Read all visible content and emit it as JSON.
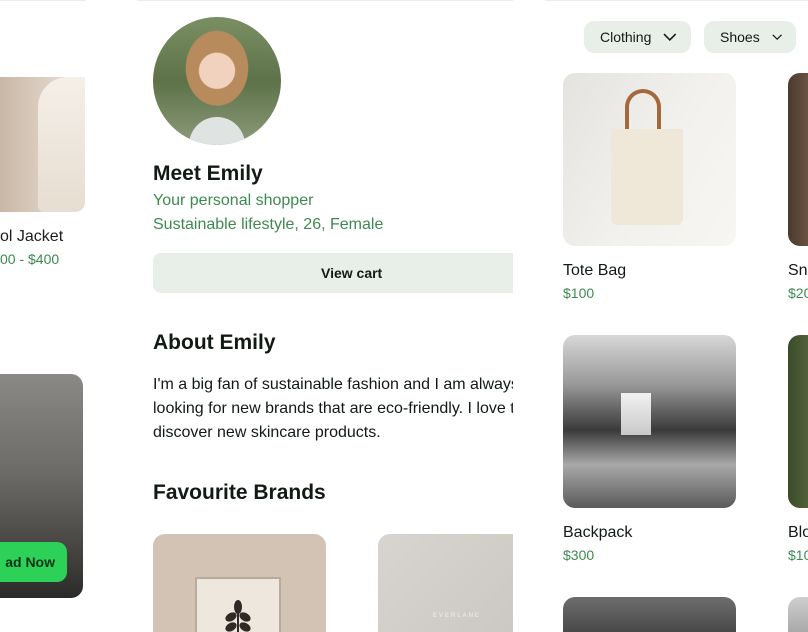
{
  "left": {
    "product_name": "ol Jacket",
    "product_price": "00 - $400",
    "promo_button": "ad Now"
  },
  "profile": {
    "name": "Meet Emily",
    "role": "Your personal shopper",
    "description": "Sustainable lifestyle, 26, Female",
    "view_cart": "View cart",
    "about_title": "About Emily",
    "about_text": "I'm a big fan of sustainable fashion and I am always looking for new brands that are eco-friendly. I love to discover new skincare products.",
    "brands_title": "Favourite Brands",
    "brand2_logo": "EVERLANE"
  },
  "shop": {
    "filters": [
      {
        "label": "Clothing",
        "icon": "chevron-down-icon"
      },
      {
        "label": "Shoes",
        "icon": "chevron-down-icon"
      }
    ],
    "products": [
      {
        "name": "Tote Bag",
        "price": "$100"
      },
      {
        "name": "Sn",
        "price": "$20"
      },
      {
        "name": "Backpack",
        "price": "$300"
      },
      {
        "name": "Blo",
        "price": "$10"
      }
    ]
  }
}
